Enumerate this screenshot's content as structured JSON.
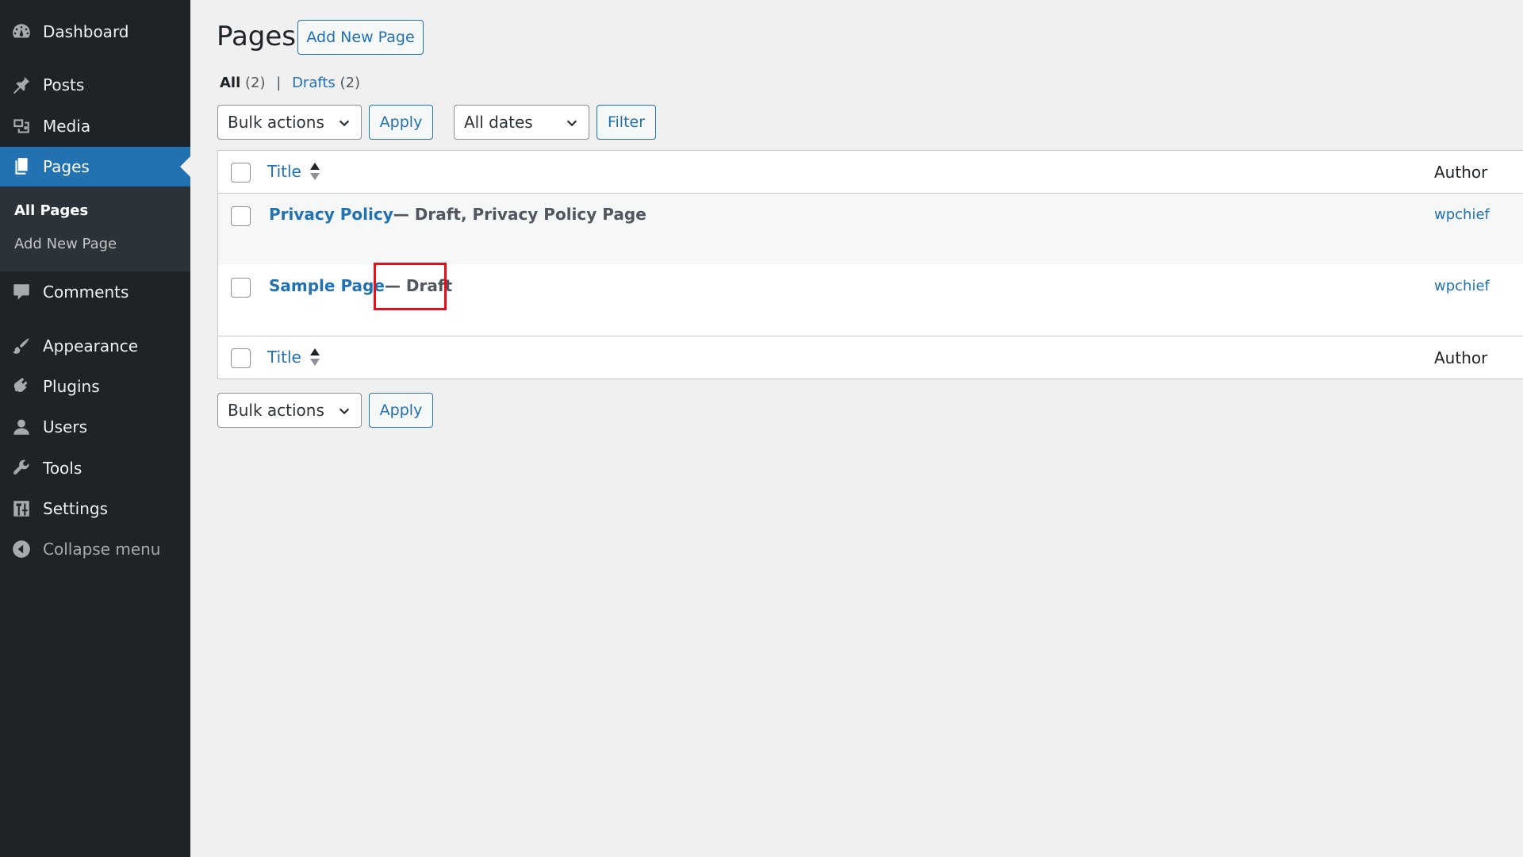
{
  "sidebar": {
    "items": [
      {
        "label": "Dashboard",
        "icon": "dashboard-icon"
      },
      {
        "label": "Posts",
        "icon": "pin-icon"
      },
      {
        "label": "Media",
        "icon": "media-icon"
      },
      {
        "label": "Pages",
        "icon": "pages-icon",
        "active": true
      },
      {
        "label": "Comments",
        "icon": "comment-icon"
      },
      {
        "label": "Appearance",
        "icon": "brush-icon"
      },
      {
        "label": "Plugins",
        "icon": "plugin-icon"
      },
      {
        "label": "Users",
        "icon": "user-icon"
      },
      {
        "label": "Tools",
        "icon": "wrench-icon"
      },
      {
        "label": "Settings",
        "icon": "settings-icon"
      },
      {
        "label": "Collapse menu",
        "icon": "collapse-icon"
      }
    ],
    "submenu": [
      {
        "label": "All Pages",
        "current": true
      },
      {
        "label": "Add New Page",
        "current": false
      }
    ]
  },
  "header": {
    "title": "Pages",
    "add_new_label": "Add New Page"
  },
  "views": {
    "all_label": "All",
    "all_count": "(2)",
    "separator": "|",
    "drafts_label": "Drafts",
    "drafts_count": "(2)"
  },
  "toolbar_top": {
    "bulk_actions": "Bulk actions",
    "apply_label": "Apply",
    "dates_select": "All dates",
    "filter_label": "Filter"
  },
  "toolbar_bottom": {
    "bulk_actions": "Bulk actions",
    "apply_label": "Apply"
  },
  "table": {
    "columns": {
      "title": "Title",
      "author": "Author"
    },
    "rows": [
      {
        "title": "Privacy Policy",
        "state": " — Draft, Privacy Policy Page",
        "author": "wpchief"
      },
      {
        "title": "Sample Page",
        "state": " — Draft",
        "author": "wpchief"
      }
    ]
  },
  "colors": {
    "sidebar_bg": "#1d2327",
    "accent": "#2271b1",
    "highlight": "#e0101d",
    "page_bg": "#f0f0f1"
  }
}
